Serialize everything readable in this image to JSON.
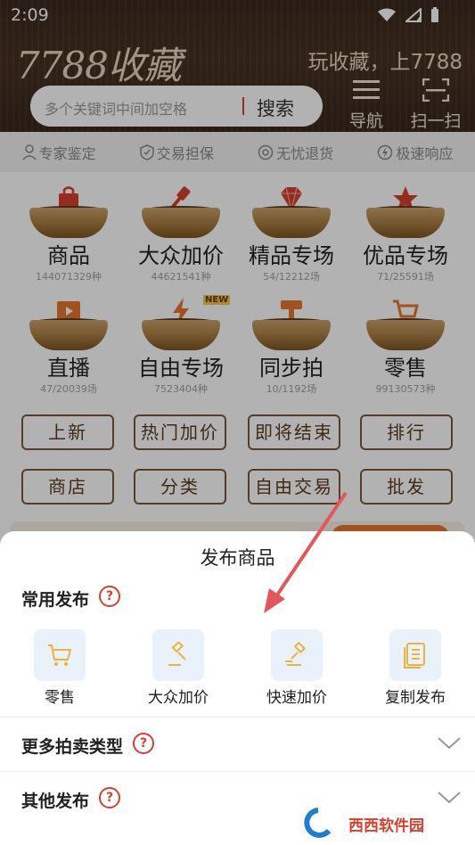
{
  "status": {
    "time": "2:09"
  },
  "header": {
    "logo": "7788收藏",
    "slogan": "玩收藏，上7788",
    "search_placeholder": "多个关键词中间加空格",
    "search_button": "搜索",
    "nav_label": "导航",
    "scan_label": "扫一扫"
  },
  "trust_bar": [
    "专家鉴定",
    "交易担保",
    "无忧退货",
    "极速响应"
  ],
  "categories": [
    {
      "name": "商品",
      "count": "144071329种",
      "icon": "shopping-bag-icon"
    },
    {
      "name": "大众加价",
      "count": "44621541种",
      "icon": "gavel-icon"
    },
    {
      "name": "精品专场",
      "count": "54/12212场",
      "icon": "diamond-icon"
    },
    {
      "name": "优品专场",
      "count": "71/25591场",
      "icon": "star-icon"
    },
    {
      "name": "直播",
      "count": "47/20039场",
      "icon": "video-icon"
    },
    {
      "name": "自由专场",
      "count": "7523404种",
      "icon": "lightning-icon",
      "badge": "NEW"
    },
    {
      "name": "同步拍",
      "count": "10/1192场",
      "icon": "sync-gavel-icon"
    },
    {
      "name": "零售",
      "count": "99130573种",
      "icon": "cart-icon"
    }
  ],
  "quick_links": [
    "上新",
    "热门加价",
    "即将结束",
    "排行",
    "商店",
    "分类",
    "自由交易",
    "批发"
  ],
  "sheet": {
    "title": "发布商品",
    "common_title": "常用发布",
    "actions": [
      {
        "label": "零售",
        "icon": "cart-icon"
      },
      {
        "label": "大众加价",
        "icon": "gavel-icon"
      },
      {
        "label": "快速加价",
        "icon": "fast-gavel-icon"
      },
      {
        "label": "复制发布",
        "icon": "copy-icon"
      }
    ],
    "more_auction": "更多拍卖类型",
    "other_publish": "其他发布",
    "help_glyph": "?"
  },
  "watermark": "西西软件园",
  "colors": {
    "accent": "#d7402e",
    "gold": "#f0b23a",
    "brown": "#5a3b1c",
    "tile": "#e9f1fb"
  }
}
